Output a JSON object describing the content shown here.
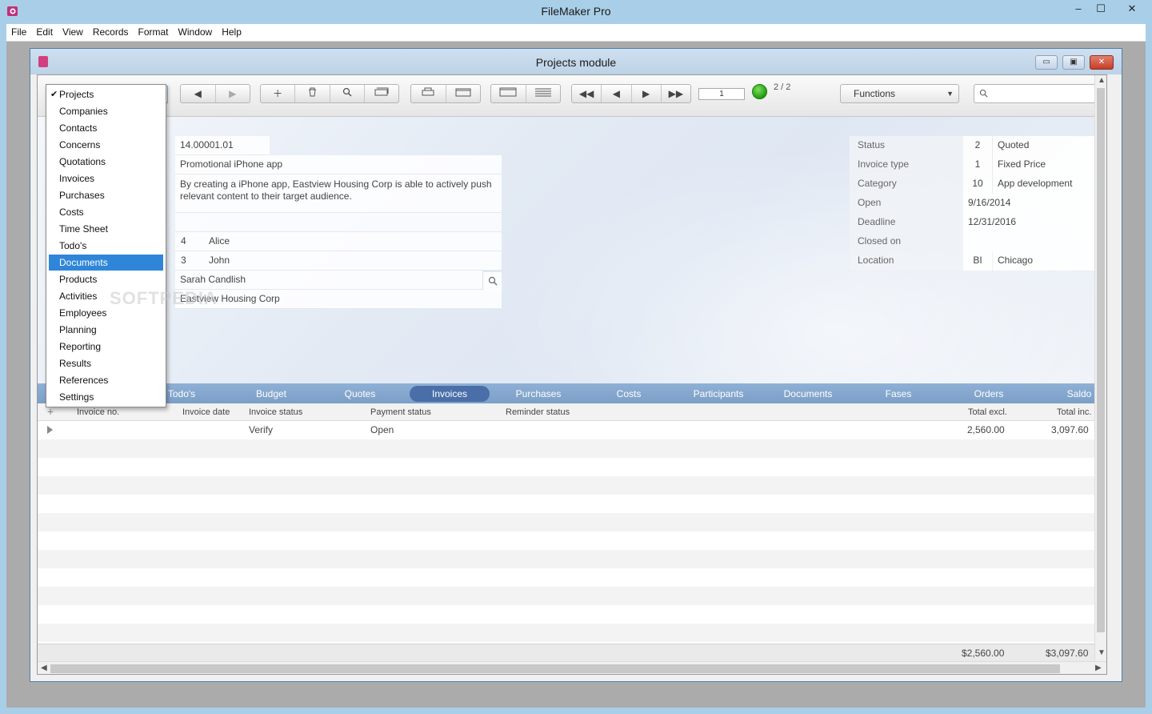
{
  "app": {
    "title": "FileMaker Pro",
    "minimize": "–",
    "maximize": "☐",
    "close": "✕"
  },
  "menu": [
    "File",
    "Edit",
    "View",
    "Records",
    "Format",
    "Window",
    "Help"
  ],
  "document": {
    "title": "Projects module",
    "minimize": "▭",
    "maximize": "▣",
    "close": "✕"
  },
  "toolbar": {
    "record_number": "1",
    "record_count": "2 / 2",
    "functions_label": "Functions",
    "search_placeholder": ""
  },
  "layouts": {
    "checked": "✔",
    "items": [
      "Projects",
      "Companies",
      "Contacts",
      "Concerns",
      "Quotations",
      "Invoices",
      "Purchases",
      "Costs",
      "Time Sheet",
      "Todo's",
      "Documents",
      "Products",
      "Activities",
      "Employees",
      "Planning",
      "Reporting",
      "Results",
      "References",
      "Settings"
    ],
    "current": "Projects",
    "highlighted": "Documents"
  },
  "project": {
    "number": "14.00001.01",
    "name": "Promotional iPhone app",
    "description": "By creating a iPhone app, Eastview Housing Corp is able to actively push relevant content to their target audience.",
    "person1_id": "4",
    "person1_name": "Alice",
    "person2_id": "3",
    "person2_name": "John",
    "contact": "Sarah Candlish",
    "company": "Eastview Housing Corp"
  },
  "details": {
    "status_label": "Status",
    "status_code": "2",
    "status_value": "Quoted",
    "invoice_type_label": "Invoice type",
    "invoice_type_code": "1",
    "invoice_type_value": "Fixed Price",
    "category_label": "Category",
    "category_code": "10",
    "category_value": "App development",
    "open_label": "Open",
    "open_value": "9/16/2014",
    "deadline_label": "Deadline",
    "deadline_value": "12/31/2016",
    "closed_label": "Closed on",
    "closed_value": "",
    "location_label": "Location",
    "location_code": "BI",
    "location_value": "Chicago"
  },
  "tabs": [
    "Todo's",
    "Budget",
    "Quotes",
    "Invoices",
    "Purchases",
    "Costs",
    "Participants",
    "Documents",
    "Fases",
    "Orders",
    "Saldo"
  ],
  "active_tab": "Invoices",
  "invoices": {
    "columns": {
      "invoice_no": "Invoice no.",
      "invoice_date": "Invoice date",
      "invoice_status": "Invoice status",
      "payment_status": "Payment status",
      "reminder_status": "Reminder status",
      "total_excl": "Total excl.",
      "total_inc": "Total inc."
    },
    "rows": [
      {
        "invoice_no": "",
        "invoice_date": "",
        "invoice_status": "Verify",
        "payment_status": "Open",
        "reminder_status": "",
        "total_excl": "2,560.00",
        "total_inc": "3,097.60"
      }
    ],
    "sum_excl": "$2,560.00",
    "sum_inc": "$3,097.60"
  },
  "watermark": "SOFTPEDIA"
}
